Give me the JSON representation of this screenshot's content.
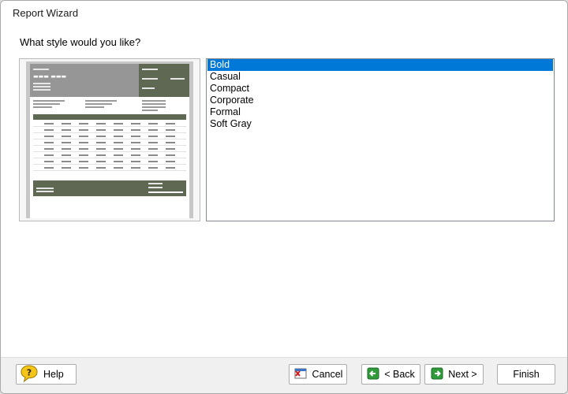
{
  "window": {
    "title": "Report Wizard"
  },
  "prompt": {
    "question": "What style would you like?"
  },
  "styles": {
    "selected_index": 0,
    "items": [
      "Bold",
      "Casual",
      "Compact",
      "Corporate",
      "Formal",
      "Soft Gray"
    ]
  },
  "buttons": {
    "help": "Help",
    "cancel": "Cancel",
    "back": "< Back",
    "next": "Next >",
    "finish": "Finish"
  },
  "colors": {
    "selection": "#0078d7",
    "preview_header_gray": "#969696",
    "preview_header_dark": "#5f6852"
  },
  "icons": {
    "help": "question-bubble-icon",
    "cancel": "cancel-document-icon",
    "back": "green-left-arrow-icon",
    "next": "green-right-arrow-icon"
  }
}
